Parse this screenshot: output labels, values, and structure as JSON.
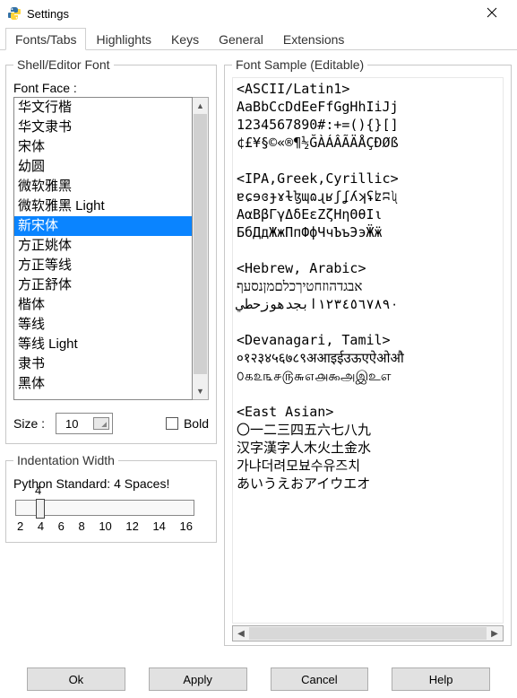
{
  "window": {
    "title": "Settings"
  },
  "tabs": [
    {
      "label": "Fonts/Tabs",
      "active": true
    },
    {
      "label": "Highlights",
      "active": false
    },
    {
      "label": "Keys",
      "active": false
    },
    {
      "label": "General",
      "active": false
    },
    {
      "label": "Extensions",
      "active": false
    }
  ],
  "shell_font": {
    "legend": "Shell/Editor Font",
    "face_label": "Font Face :",
    "fonts": [
      "华文行楷",
      "华文隶书",
      "宋体",
      "幼圆",
      "微软雅黑",
      "微软雅黑 Light",
      "新宋体",
      "方正姚体",
      "方正等线",
      "方正舒体",
      "楷体",
      "等线",
      "等线 Light",
      "隶书",
      "黑体"
    ],
    "selected_font": "新宋体",
    "size_label": "Size :",
    "size_value": "10",
    "bold_label": "Bold",
    "bold_checked": false
  },
  "indentation": {
    "legend": "Indentation Width",
    "standard": "Python Standard: 4 Spaces!",
    "value": 4,
    "ticks": [
      "2",
      "4",
      "6",
      "8",
      "10",
      "12",
      "14",
      "16"
    ]
  },
  "sample": {
    "legend": "Font Sample (Editable)",
    "text": "<ASCII/Latin1>\nAaBbCcDdEeFfGgHhIiJj\n1234567890#:+=(){}[]\n¢£¥§©«®¶½ĞÀÁÂÃÄÅÇÐØß\n\n<IPA,Greek,Cyrillic>\nɐɕɘɞɟɤɫɮɰɷɻʁʃʆʎʞʢʫʭʯ\nΑαΒβΓγΔδΕεΖζΗηΘθΙι\nБбДдЖжПпФфЧчЪъЭэӜӝ\n\n<Hebrew, Arabic>\nאבגדהוזחטיךכלםמןנסעף\n١٢٣٤٥٦٧٨٩٠ابجدهوزحطي\n\n<Devanagari, Tamil>\n०१२३४५६७८९अआइईउऊएऐओऔ\n௦௧௨௩௪௫௬௭௮௯அஇஉஎ\n\n<East Asian>\n〇一二三四五六七八九\n汉字漢字人木火土金水\n가냐더려모뵤수유즈치\nあいうえおアイウエオ"
  },
  "buttons": {
    "ok": "Ok",
    "apply": "Apply",
    "cancel": "Cancel",
    "help": "Help"
  }
}
